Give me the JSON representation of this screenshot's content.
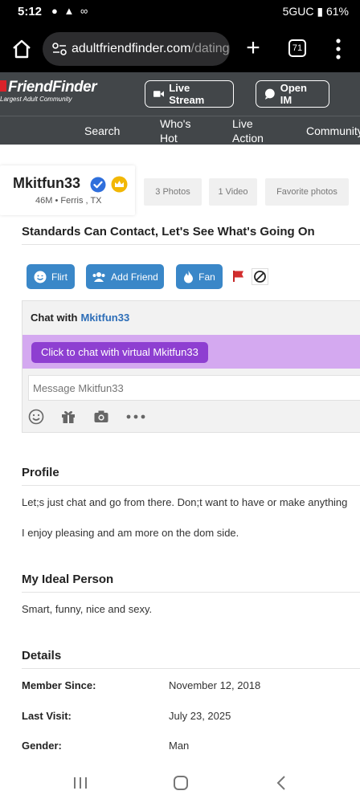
{
  "status_bar": {
    "time": "5:12",
    "notification_icons": "● ▲ ∞",
    "network": "5GUC",
    "battery": "61%"
  },
  "browser": {
    "url_main": "adultfriendfinder.com",
    "url_dim": "/dating",
    "tab_count": "71"
  },
  "site": {
    "brand": "FriendFinder",
    "tagline": "Largest Adult Community",
    "live_stream_label": "Live Stream",
    "open_im_label": "Open IM",
    "nav": {
      "search": "Search",
      "whos_hot_1": "Who's",
      "whos_hot_2": "Hot",
      "live_action_1": "Live",
      "live_action_2": "Action",
      "community": "Community"
    }
  },
  "profile": {
    "username": "Mkitfun33",
    "meta": "46M • Ferris , TX",
    "tabs": {
      "photos": "3 Photos",
      "video": "1 Video",
      "favorites": "Favorite photos"
    },
    "headline": "Standards Can Contact, Let's See What's Going On",
    "actions": {
      "flirt": "Flirt",
      "add_friend": "Add Friend",
      "fan": "Fan"
    },
    "colors": {
      "action_blue": "#3a87c8",
      "virtual_purple": "#8e3fd1",
      "header_gray": "#424649"
    }
  },
  "chat": {
    "label": "Chat with",
    "who": "Mkitfun33",
    "virtual_button": "Click to chat with virtual Mkitfun33",
    "placeholder": "Message Mkitfun33"
  },
  "sections": {
    "profile_title": "Profile",
    "profile_text_1": "Let;s just chat and go from there. Don;t want to have or make anything",
    "profile_text_2": "I enjoy pleasing and am more on the dom side.",
    "ideal_title": "My Ideal Person",
    "ideal_text": "Smart, funny, nice and sexy.",
    "details_title": "Details"
  },
  "details": {
    "member_since_label": "Member Since:",
    "member_since_value": "November 12, 2018",
    "last_visit_label": "Last Visit:",
    "last_visit_value": "July 23, 2025",
    "gender_label": "Gender:",
    "gender_value": "Man"
  }
}
